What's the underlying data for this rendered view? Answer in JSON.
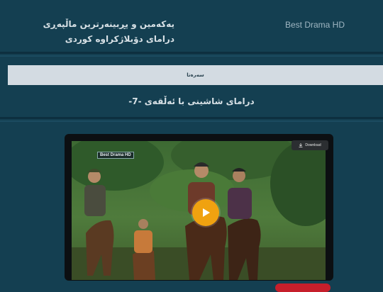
{
  "site": {
    "brand": "Best Drama HD",
    "tagline": "یەکەمین و پڕبینەرترین ماڵپەڕی درامای دۆبلاژکراوە کوردی"
  },
  "nav": {
    "home_label": "سەرەتا"
  },
  "episode": {
    "title": "درامای شاشینی با ئەڵقەی -7-"
  },
  "player": {
    "channel_logo": "Best Drama HD",
    "download_label": "Download",
    "download_icon": "download-icon",
    "play_icon": "play-icon",
    "accent": "#f0a210"
  },
  "colors": {
    "background": "#143f51",
    "nav_bar": "#d3dbe2",
    "accent_red": "#c61f2b"
  }
}
